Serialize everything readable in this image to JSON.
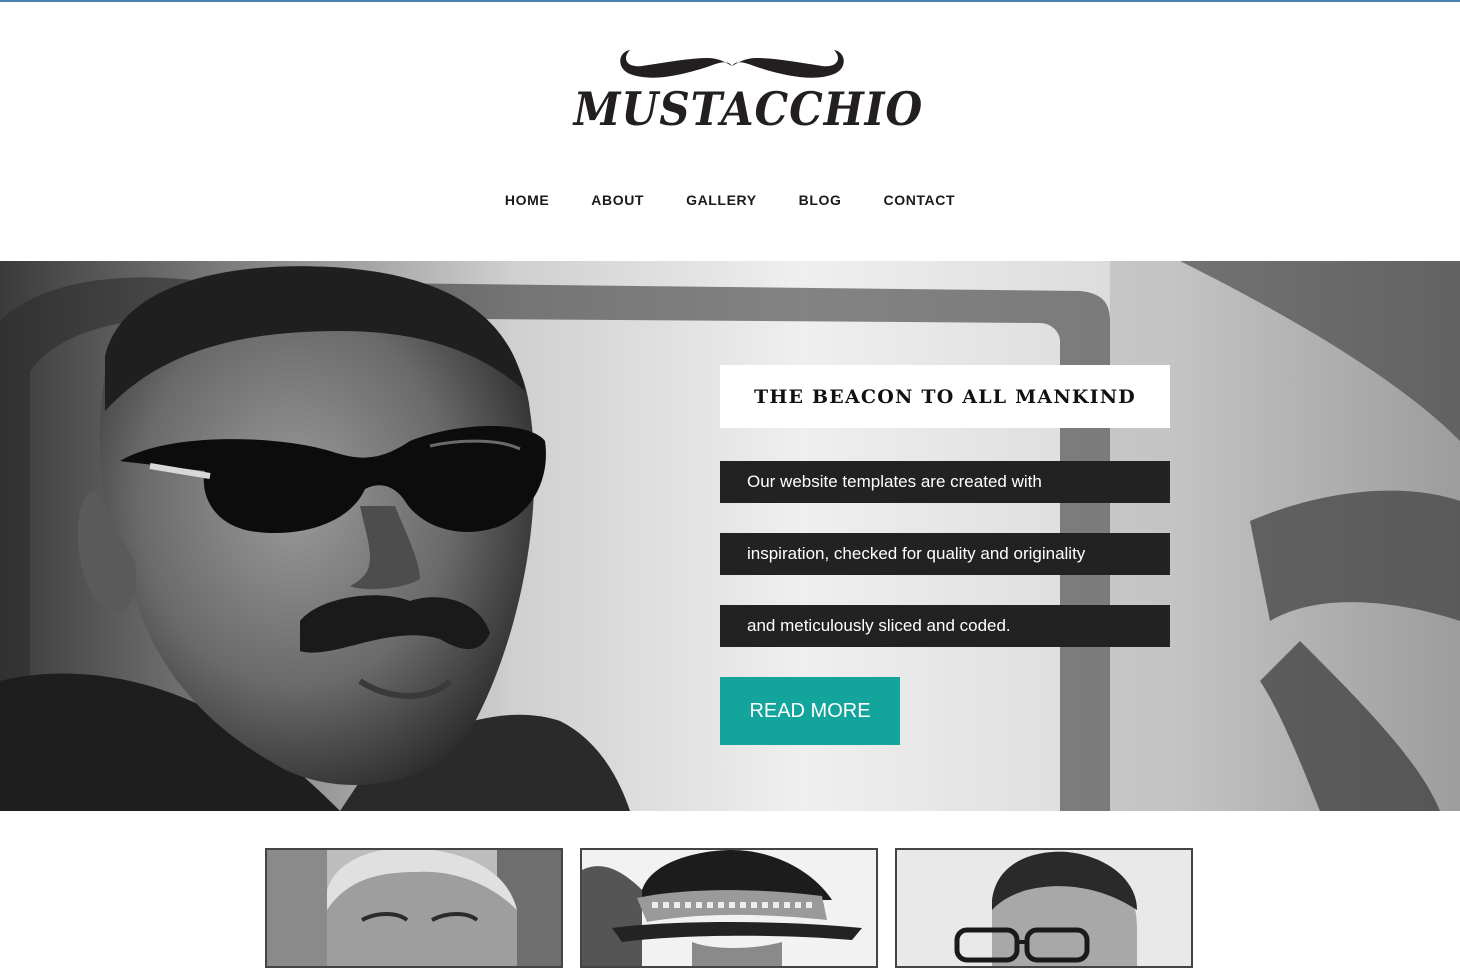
{
  "brand": {
    "name": "MUSTACCHIO"
  },
  "nav": {
    "items": [
      "HOME",
      "ABOUT",
      "GALLERY",
      "BLOG",
      "CONTACT"
    ]
  },
  "hero": {
    "title": "THE BEACON TO ALL MANKIND",
    "lines": [
      "Our website templates are created with",
      "inspiration, checked for quality and originality",
      "and meticulously sliced and coded."
    ],
    "button_label": "READ MORE"
  },
  "colors": {
    "accent": "#13a59c",
    "text_bar": "#222222",
    "top_rule": "#4a7fa8"
  }
}
